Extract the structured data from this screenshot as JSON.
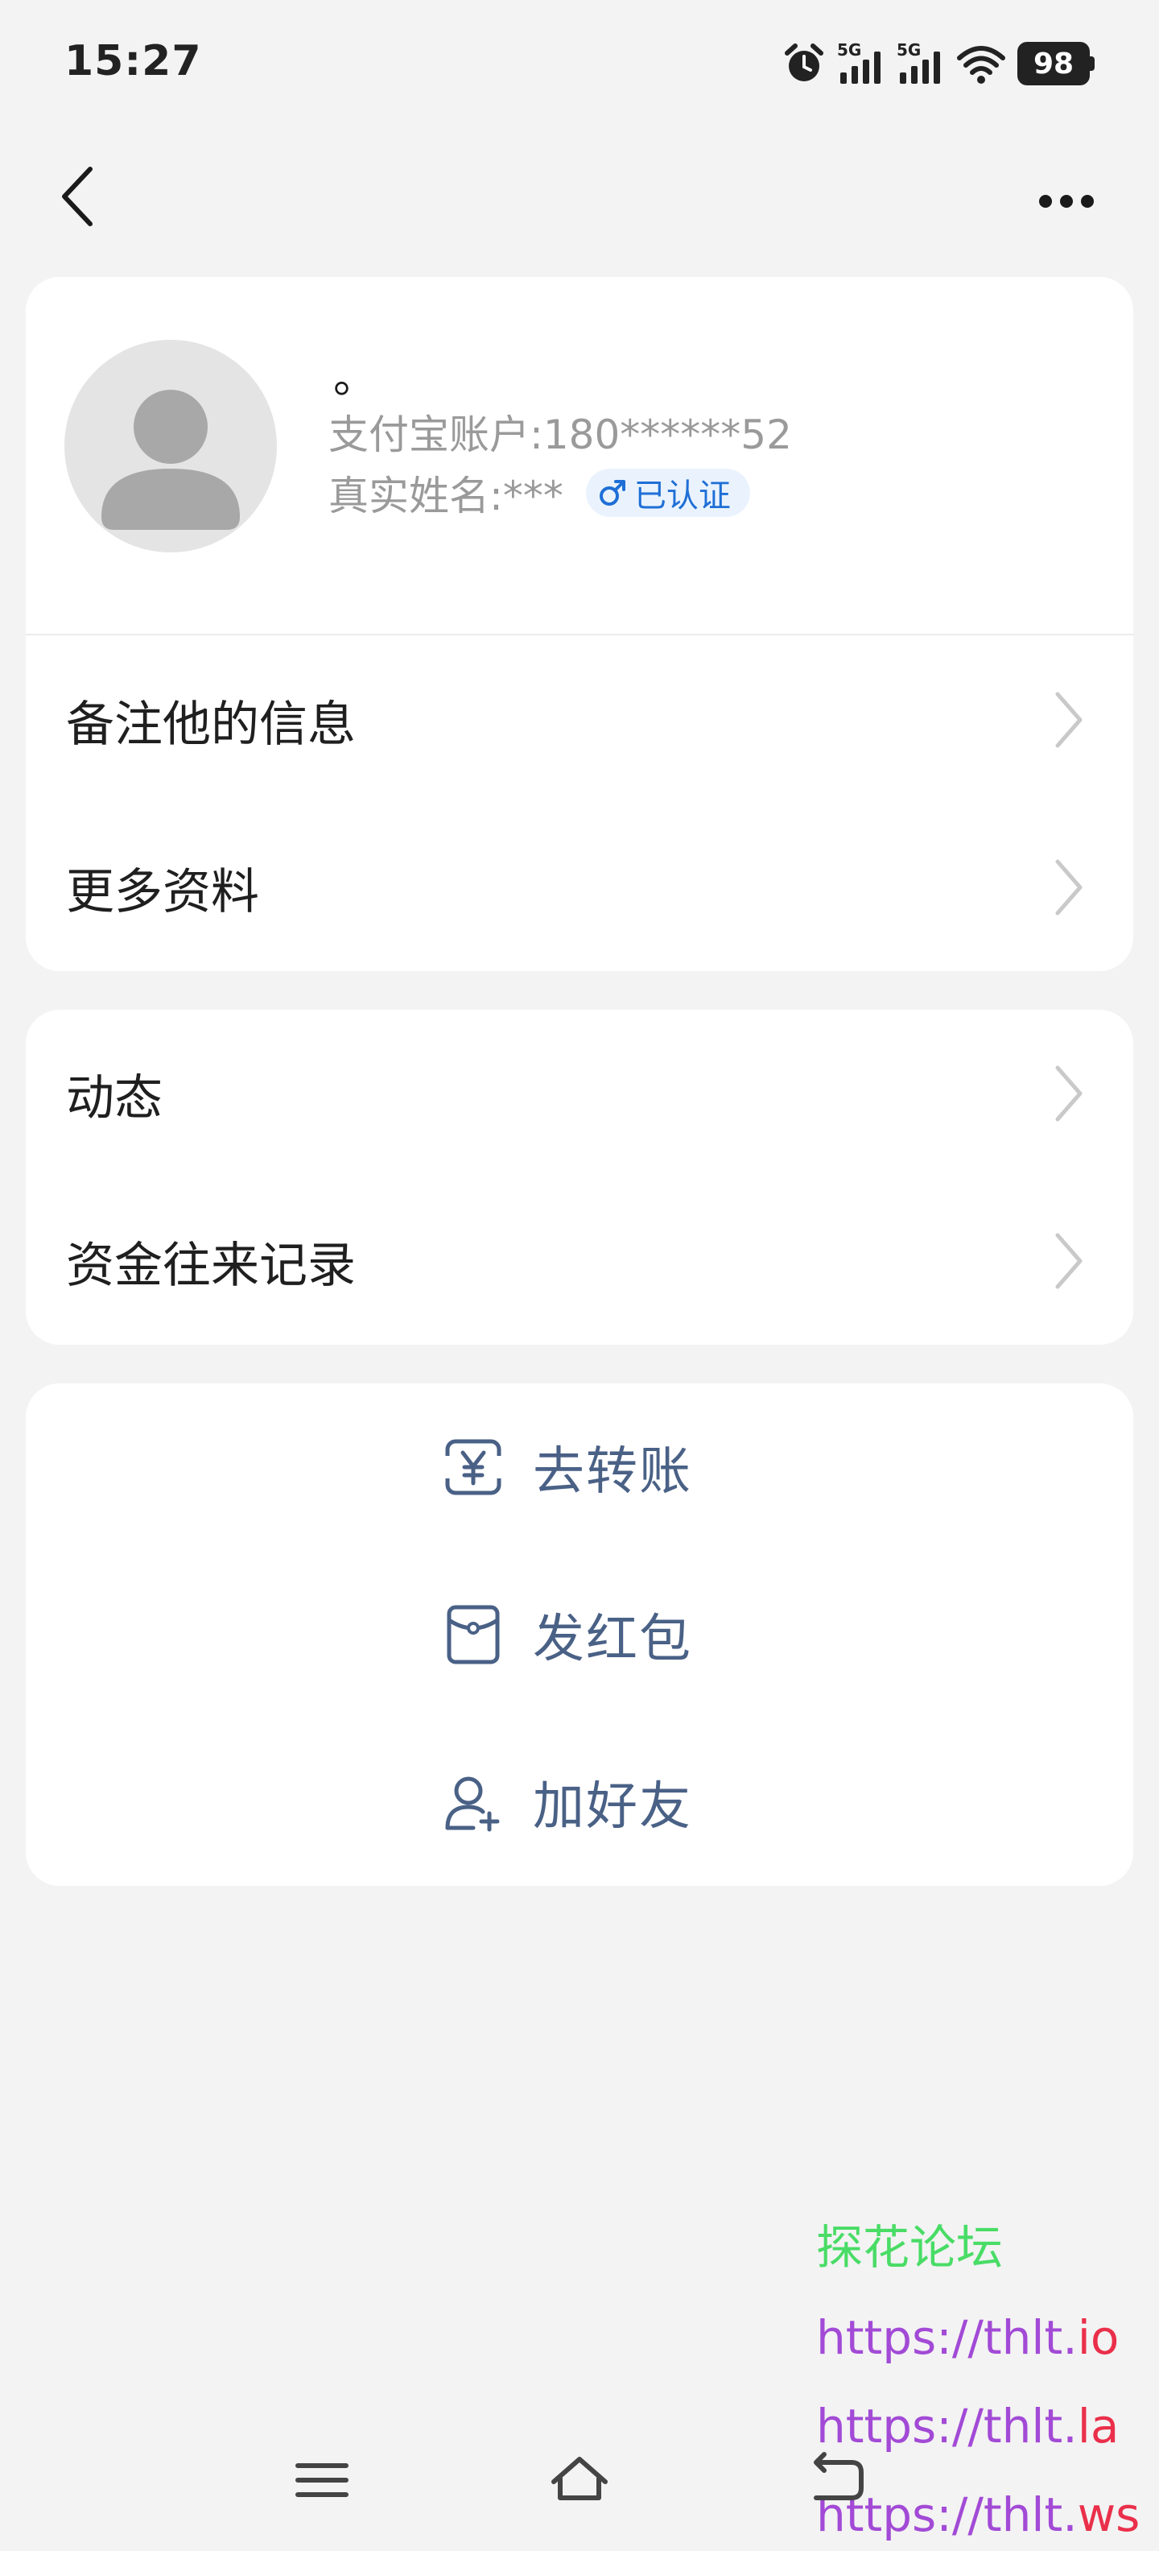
{
  "status_bar": {
    "time": "15:27",
    "signal1_label": "5G",
    "signal2_label": "5G",
    "battery": "98",
    "icons": [
      "alarm-icon",
      "signal-5g-icon",
      "signal-5g-icon",
      "wifi-icon",
      "battery-icon"
    ]
  },
  "nav": {
    "icons": [
      "back-arrow-icon",
      "more-dots-icon"
    ]
  },
  "profile": {
    "nickname": "。",
    "account": "支付宝账户:180******52",
    "real_name": "真实姓名:***",
    "verified_label": "已认证",
    "gender_icon": "male-icon"
  },
  "info_menu": [
    {
      "label": "备注他的信息"
    },
    {
      "label": "更多资料"
    }
  ],
  "activity_menu": [
    {
      "label": "动态"
    },
    {
      "label": "资金往来记录"
    }
  ],
  "actions": [
    {
      "label": "去转账",
      "icon": "transfer-yuan-icon"
    },
    {
      "label": "发红包",
      "icon": "red-envelope-icon"
    },
    {
      "label": "加好友",
      "icon": "add-friend-icon"
    }
  ],
  "watermark": {
    "title": "探花论坛",
    "links": [
      {
        "prefix": "https://thlt.",
        "suffix": "io"
      },
      {
        "prefix": "https://thlt.",
        "suffix": "la"
      },
      {
        "prefix": "https://thlt.",
        "suffix": "ws"
      }
    ]
  },
  "colors": {
    "background": "#f3f3f3",
    "card": "#ffffff",
    "action_text": "#4a6186",
    "verified_blue": "#1f6fd6",
    "watermark_green": "#49dc66",
    "watermark_purple": "#a24ad6",
    "watermark_red": "#ea2f4a"
  }
}
